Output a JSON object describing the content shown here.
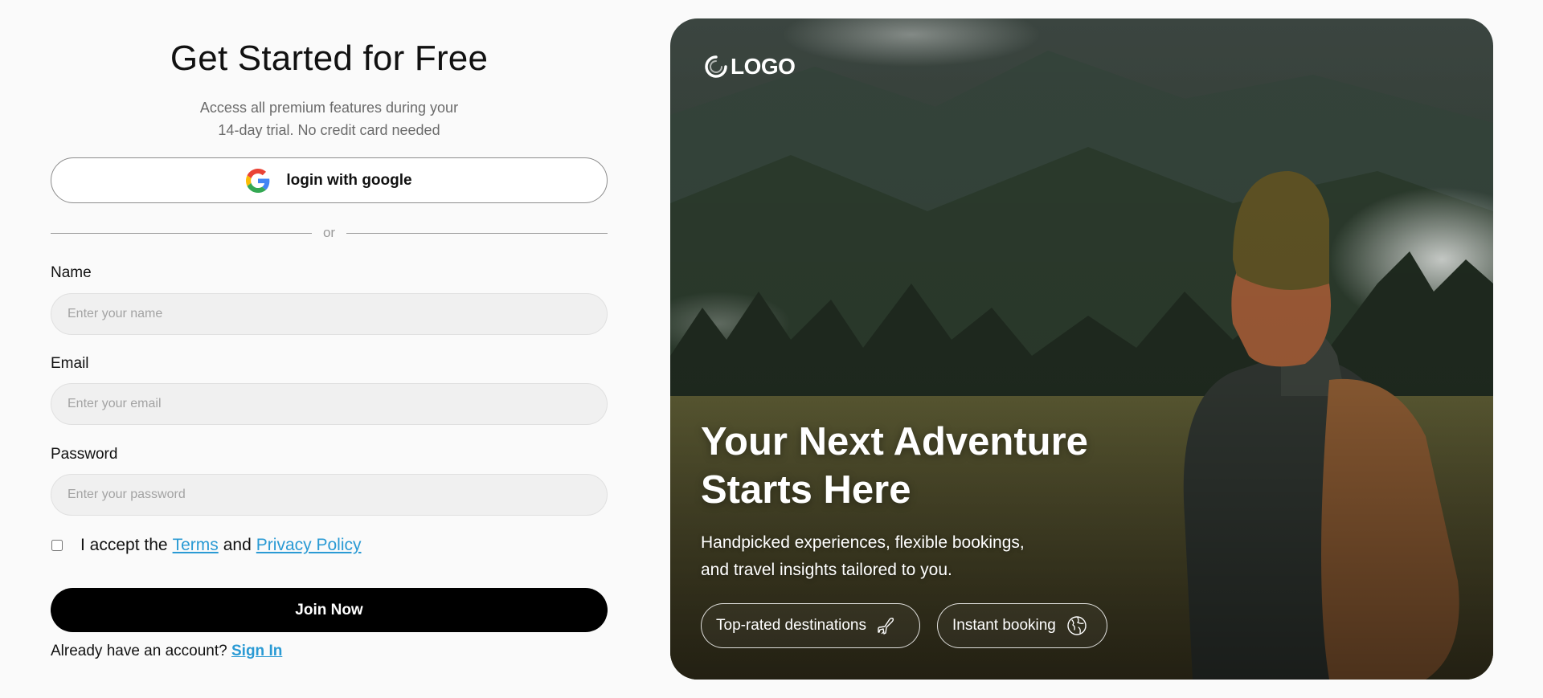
{
  "form": {
    "title": "Get Started for Free",
    "subtitle_line1": "Access all premium features during your",
    "subtitle_line2": "14-day trial. No credit card needed",
    "google_button": "login with google",
    "divider_text": "or",
    "name": {
      "label": "Name",
      "placeholder": "Enter your name"
    },
    "email": {
      "label": "Email",
      "placeholder": "Enter your email"
    },
    "password": {
      "label": "Password",
      "placeholder": "Enter your password"
    },
    "terms": {
      "prefix": "I accept the",
      "terms_link": "Terms",
      "conjunction": "and",
      "privacy_link": "Privacy Policy",
      "checked": false
    },
    "join_button": "Join Now",
    "signin_prompt": "Already have an account?",
    "signin_link": "Sign In"
  },
  "hero": {
    "logo_text": "LOGO",
    "headline_line1": "Your Next Adventure",
    "headline_line2": "Starts Here",
    "tagline_line1": "Handpicked experiences, flexible bookings,",
    "tagline_line2": "and travel insights tailored to you.",
    "chips": [
      {
        "label": "Top-rated destinations",
        "icon": "airplane-icon"
      },
      {
        "label": "Instant booking",
        "icon": "globe-icon"
      }
    ]
  },
  "colors": {
    "link": "#2a9ad4",
    "primary_button": "#000000",
    "input_background": "#f0f0f0",
    "page_background": "#fafafa"
  }
}
